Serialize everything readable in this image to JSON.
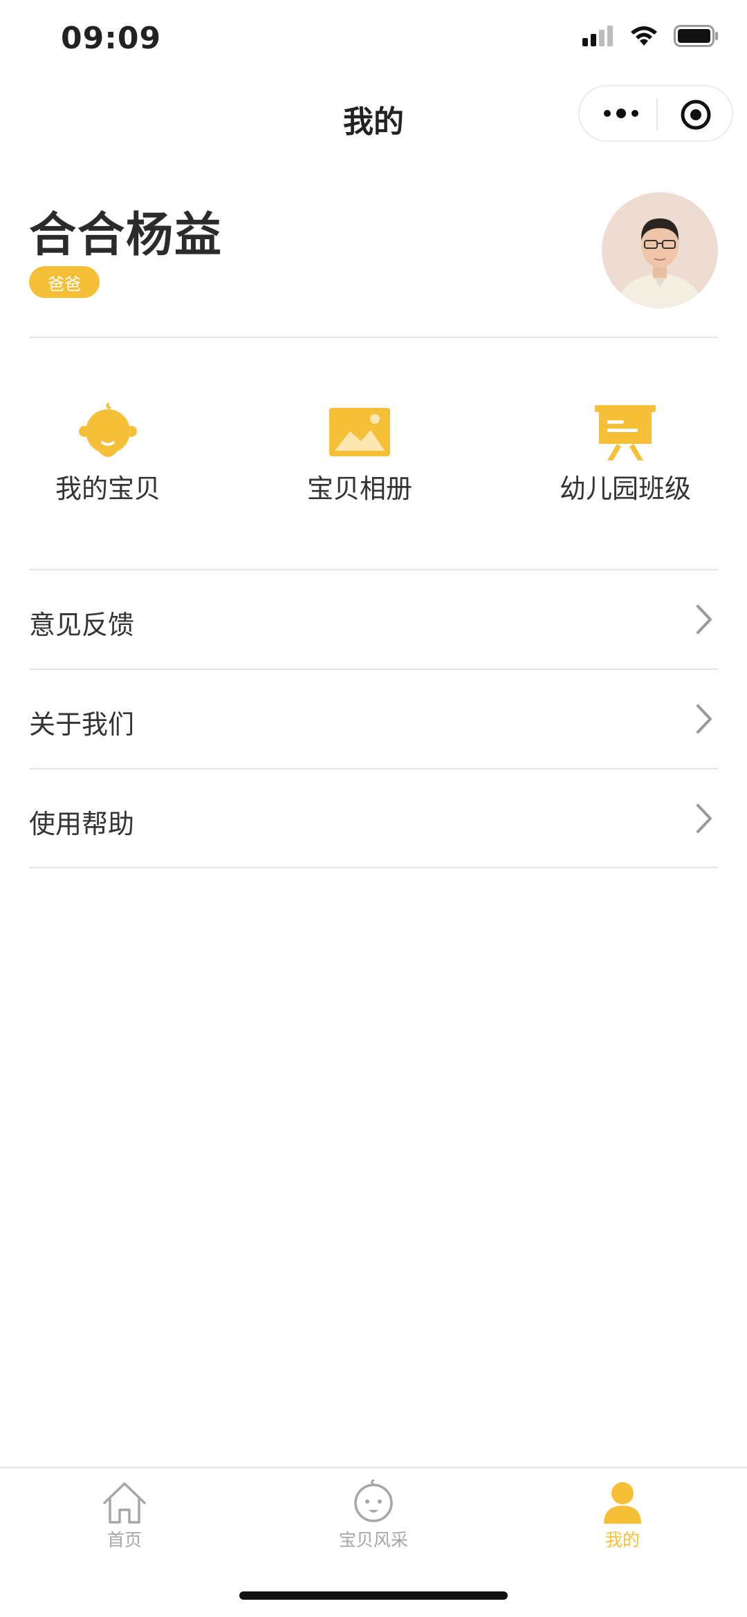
{
  "status": {
    "time": "09:09"
  },
  "nav": {
    "title": "我的"
  },
  "profile": {
    "name": "合合杨益",
    "role": "爸爸"
  },
  "features": [
    {
      "label": "我的宝贝",
      "icon": "baby-face-icon"
    },
    {
      "label": "宝贝相册",
      "icon": "image-icon"
    },
    {
      "label": "幼儿园班级",
      "icon": "blackboard-icon"
    }
  ],
  "menu": [
    {
      "label": "意见反馈"
    },
    {
      "label": "关于我们"
    },
    {
      "label": "使用帮助"
    }
  ],
  "tabs": [
    {
      "label": "首页",
      "icon": "home-icon",
      "active": false
    },
    {
      "label": "宝贝风采",
      "icon": "baby-face-icon",
      "active": false
    },
    {
      "label": "我的",
      "icon": "person-icon",
      "active": true
    }
  ],
  "colors": {
    "accent": "#f6bf38",
    "inactive": "#a6a6a6",
    "divider": "#e5e5e5"
  }
}
